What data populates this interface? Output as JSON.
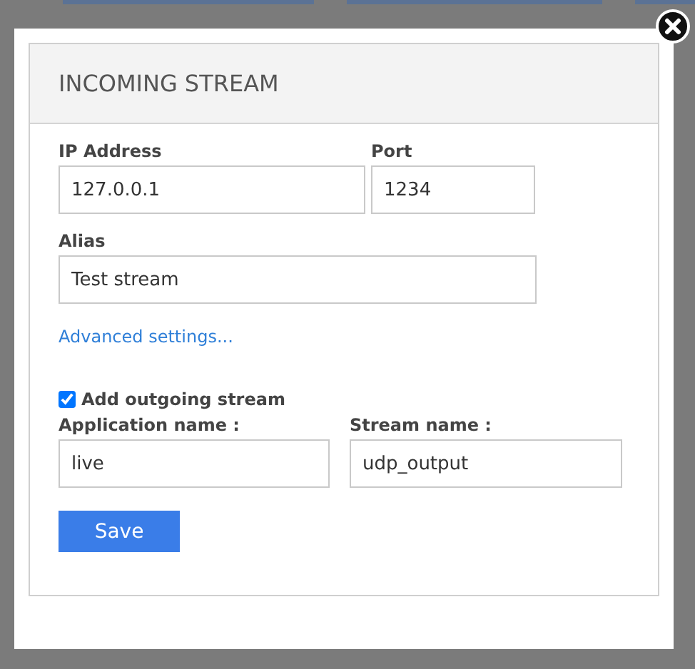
{
  "dialog": {
    "title": "INCOMING STREAM",
    "fields": [
      {
        "label": "IP Address",
        "value": "127.0.0.1"
      },
      {
        "label": "Port",
        "value": "1234"
      },
      {
        "label": "Alias",
        "value": "Test stream"
      }
    ],
    "advanced_link": "Advanced settings...",
    "outgoing": {
      "label": "Add outgoing stream",
      "checked": true
    },
    "outgoing_fields": [
      {
        "label": "Application name :",
        "value": "live"
      },
      {
        "label": "Stream name :",
        "value": "udp_output"
      }
    ],
    "save_button": "Save"
  }
}
